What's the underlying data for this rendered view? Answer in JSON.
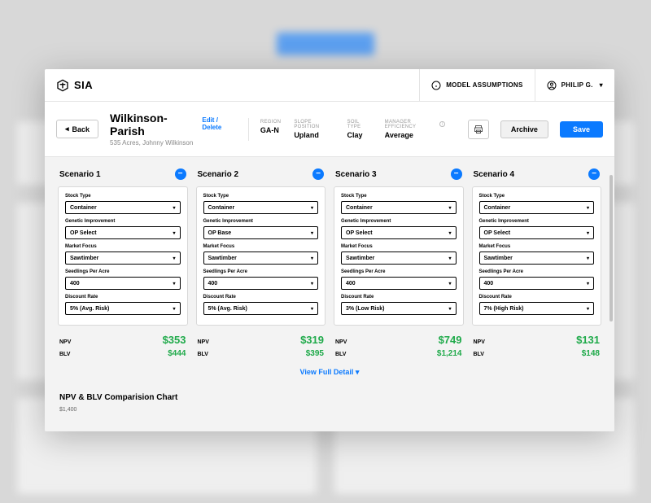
{
  "brand": "SIA",
  "topbar": {
    "assumptions": "MODEL ASSUMPTIONS",
    "user": "PHILIP G."
  },
  "header": {
    "back": "Back",
    "title": "Wilkinson-Parish",
    "edit": "Edit",
    "delete": "Delete",
    "subtitle": "535 Acres, Johnny Wilkinson",
    "archive": "Archive",
    "save": "Save"
  },
  "meta": {
    "region_label": "REGION",
    "region_value": "GA-N",
    "slope_label": "SLOPE POSITION",
    "slope_value": "Upland",
    "soil_label": "SOIL TYPE",
    "soil_value": "Clay",
    "eff_label": "MANAGER EFFICIENCY",
    "eff_value": "Average"
  },
  "field_labels": {
    "stock": "Stock Type",
    "genetic": "Genetic Improvement",
    "market": "Market Focus",
    "seedlings": "Seedlings Per Acre",
    "discount": "Discount Rate"
  },
  "result_labels": {
    "npv": "NPV",
    "blv": "BLV"
  },
  "scenarios": [
    {
      "title": "Scenario 1",
      "stock": "Container",
      "genetic": "OP Select",
      "market": "Sawtimber",
      "seedlings": "400",
      "discount": "5% (Avg. Risk)",
      "npv": "$353",
      "blv": "$444"
    },
    {
      "title": "Scenario 2",
      "stock": "Container",
      "genetic": "OP Base",
      "market": "Sawtimber",
      "seedlings": "400",
      "discount": "5% (Avg. Risk)",
      "npv": "$319",
      "blv": "$395"
    },
    {
      "title": "Scenario 3",
      "stock": "Container",
      "genetic": "OP Select",
      "market": "Sawtimber",
      "seedlings": "400",
      "discount": "3% (Low Risk)",
      "npv": "$749",
      "blv": "$1,214"
    },
    {
      "title": "Scenario 4",
      "stock": "Container",
      "genetic": "OP Select",
      "market": "Sawtimber",
      "seedlings": "400",
      "discount": "7% (High Risk)",
      "npv": "$131",
      "blv": "$148"
    }
  ],
  "view_detail": "View Full Detail",
  "chart": {
    "title": "NPV & BLV Comparision Chart",
    "ymax": "$1,400"
  }
}
